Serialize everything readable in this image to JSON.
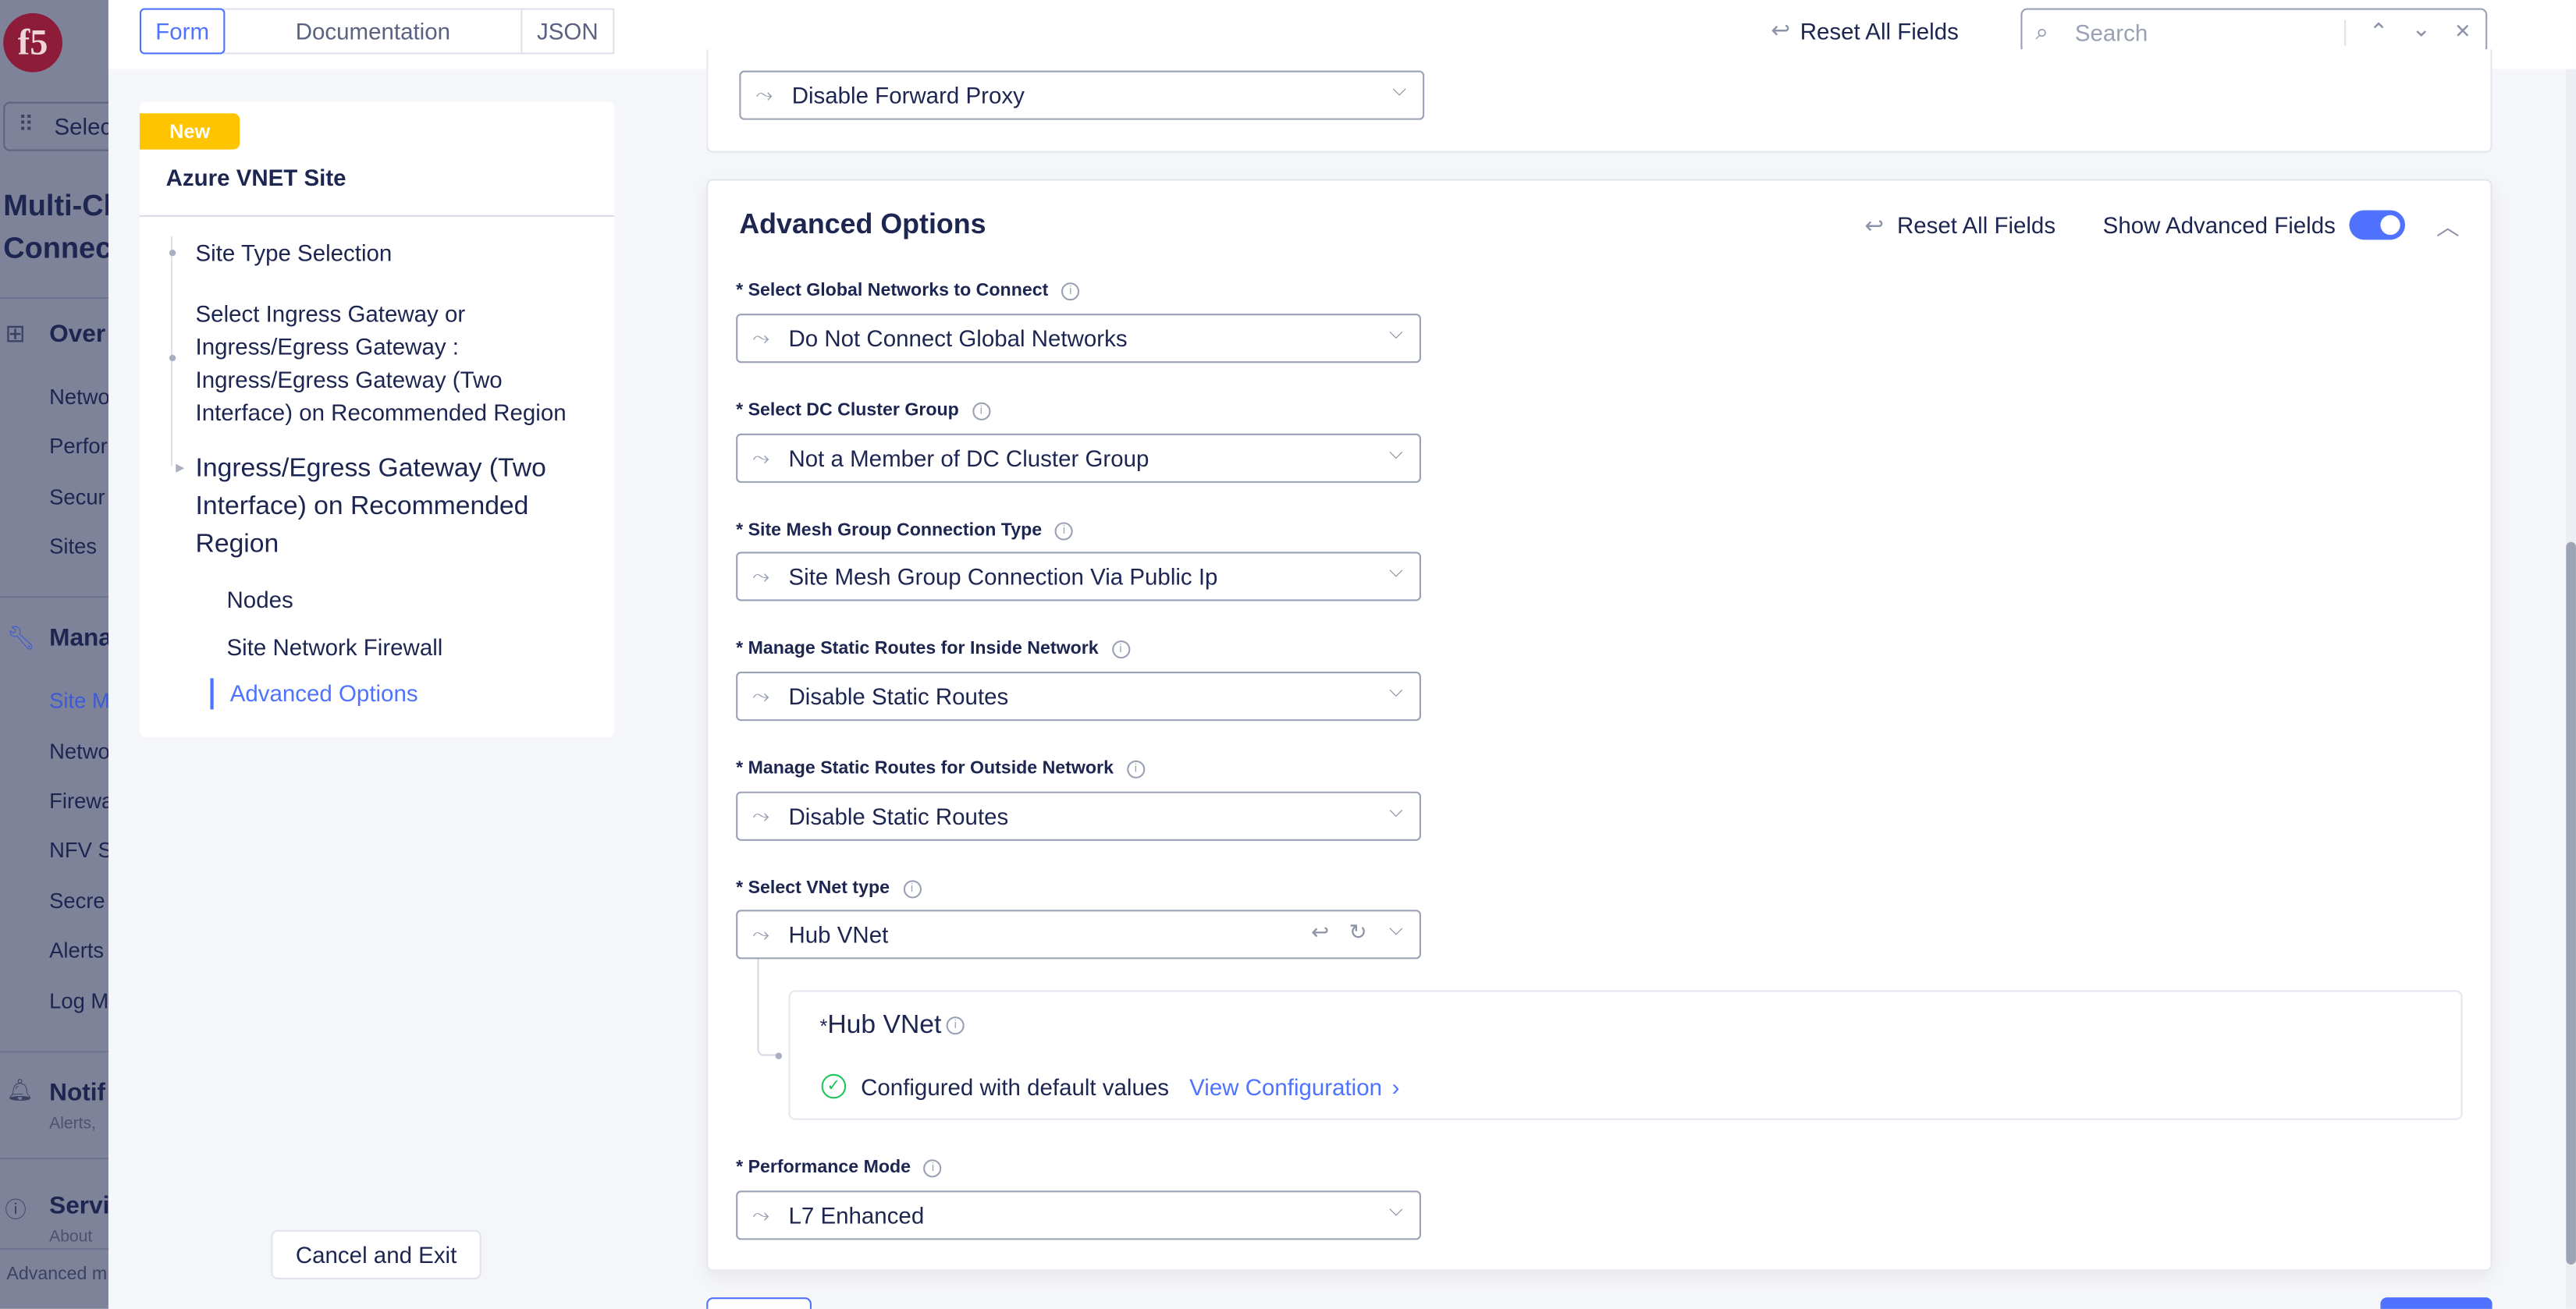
{
  "background_sidebar": {
    "logo": "f5",
    "select_label": "Selec",
    "title_line1": "Multi-Cl",
    "title_line2": "Connec",
    "sections": [
      {
        "label": "Over",
        "icon": "grid-icon",
        "items": [
          "Netwo",
          "Perfor",
          "Secur",
          "Sites"
        ]
      },
      {
        "label": "Mana",
        "icon": "wrench-icon",
        "items": [
          "Site M",
          "Netwo",
          "Firewa",
          "NFV S",
          "Secre",
          "Alerts",
          "Log M"
        ]
      },
      {
        "label": "Notif",
        "icon": "bell-icon",
        "subtitle": "Alerts,"
      },
      {
        "label": "Servi",
        "icon": "info-icon",
        "subtitle": "About"
      }
    ],
    "footer": "Advanced m"
  },
  "topbar": {
    "tabs": [
      {
        "label": "Form",
        "active": true
      },
      {
        "label": "Documentation",
        "active": false
      },
      {
        "label": "JSON",
        "active": false
      }
    ],
    "reset_label": "Reset All Fields",
    "search_placeholder": "Search",
    "search_value": ""
  },
  "nav": {
    "badge": "New",
    "title": "Azure VNET Site",
    "items": [
      "Site Type Selection",
      "Select Ingress Gateway or Ingress/Egress Gateway : Ingress/Egress Gateway (Two Interface) on Recommended Region",
      "Ingress/Egress Gateway (Two Interface) on Recommended Region"
    ],
    "subitems": [
      "Nodes",
      "Site Network Firewall",
      "Advanced Options"
    ],
    "active_subitem": "Advanced Options",
    "cancel_label": "Cancel and Exit"
  },
  "form": {
    "forward_proxy_value": "Disable Forward Proxy",
    "advanced": {
      "title": "Advanced Options",
      "reset_label": "Reset All Fields",
      "show_advanced_label": "Show Advanced Fields",
      "show_advanced_on": true,
      "fields": [
        {
          "label": "* Select Global Networks to Connect",
          "value": "Do Not Connect Global Networks"
        },
        {
          "label": "* Select DC Cluster Group",
          "value": "Not a Member of DC Cluster Group"
        },
        {
          "label": "* Site Mesh Group Connection Type",
          "value": "Site Mesh Group Connection Via Public Ip"
        },
        {
          "label": "* Manage Static Routes for Inside Network",
          "value": "Disable Static Routes"
        },
        {
          "label": "* Manage Static Routes for Outside Network",
          "value": "Disable Static Routes"
        },
        {
          "label": "* Select VNet type",
          "value": "Hub VNet"
        },
        {
          "label": "* Performance Mode",
          "value": "L7 Enhanced"
        }
      ],
      "hub": {
        "asterisk": "*",
        "title": "Hub VNet",
        "status": "Configured with default values",
        "link": "View Configuration"
      }
    }
  },
  "colors": {
    "accent": "#4f73ff",
    "badge": "#ffc400",
    "success": "#22c55e",
    "text": "#1d2551"
  }
}
